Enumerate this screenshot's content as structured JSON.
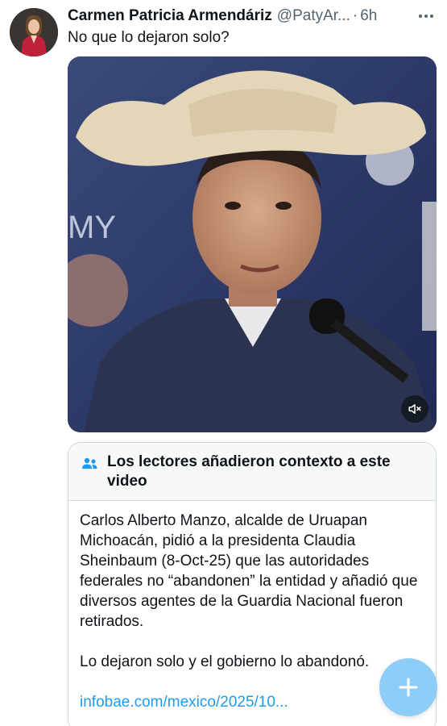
{
  "tweet": {
    "author_name": "Carmen Patricia Armendáriz",
    "handle": "@PatyAr...",
    "separator": "·",
    "time": "6h",
    "text": "No que lo dejaron solo?"
  },
  "media": {
    "type": "video",
    "mute_icon": "speaker-muted-icon"
  },
  "community_notes": {
    "icon": "people-icon",
    "title": "Los lectores añadieron contexto a este video",
    "paragraph1": "Carlos Alberto Manzo, alcalde de Uruapan Michoacán, pidió a la presidenta Claudia Sheinbaum (8-Oct-25) que las autoridades federales no “abandonen” la entidad y añadió que diversos agentes de la Guardia Nacional fueron retirados.",
    "paragraph2": "Lo dejaron solo y el gobierno lo abandonó.",
    "link": "infobae.com/mexico/2025/10..."
  },
  "fab": {
    "icon": "plus-icon"
  },
  "colors": {
    "accent": "#1d9bf0",
    "muted": "#536471",
    "fab": "#8ecdf8"
  }
}
